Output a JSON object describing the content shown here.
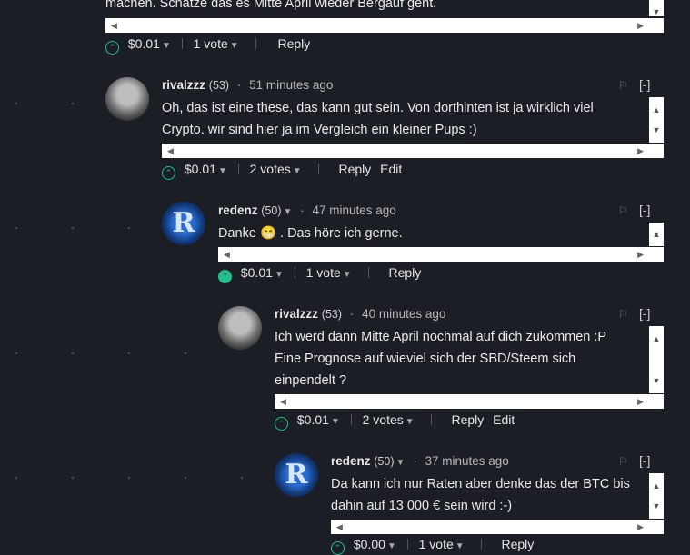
{
  "top_comment": {
    "body_fragment": "machen. Schätze das es Mitte April wieder Bergauf geht.",
    "payout": "$0.01",
    "votes": "1 vote",
    "reply": "Reply"
  },
  "comments": [
    {
      "author": "rivalzzz",
      "reputation": "(53)",
      "time": "51 minutes ago",
      "collapse": "[-]",
      "body": [
        "Oh, das ist eine these, das kann gut sein. Von dorthinten ist ja wirklich viel",
        "Crypto. wir sind hier ja im Vergleich ein kleiner Pups :)"
      ],
      "payout": "$0.01",
      "votes": "2 votes",
      "reply": "Reply",
      "edit": "Edit"
    },
    {
      "author": "redenz",
      "reputation": "(50)",
      "time": "47 minutes ago",
      "collapse": "[-]",
      "body": [
        "Danke 😁 . Das höre ich gerne."
      ],
      "payout": "$0.01",
      "votes": "1 vote",
      "reply": "Reply"
    },
    {
      "author": "rivalzzz",
      "reputation": "(53)",
      "time": "40 minutes ago",
      "collapse": "[-]",
      "body": [
        "Ich werd dann Mitte April nochmal auf dich zukommen :P",
        "Eine Prognose auf wieviel sich der SBD/Steem sich",
        "einpendelt ?"
      ],
      "payout": "$0.01",
      "votes": "2 votes",
      "reply": "Reply",
      "edit": "Edit"
    },
    {
      "author": "redenz",
      "reputation": "(50)",
      "time": "37 minutes ago",
      "collapse": "[-]",
      "body": [
        "Da kann ich nur Raten aber denke das der BTC bis",
        "dahin auf 13 000 € sein wird :-)"
      ],
      "payout": "$0.00",
      "votes": "1 vote",
      "reply": "Reply"
    }
  ],
  "icons": {
    "avatar_redenz_letter": "R"
  }
}
